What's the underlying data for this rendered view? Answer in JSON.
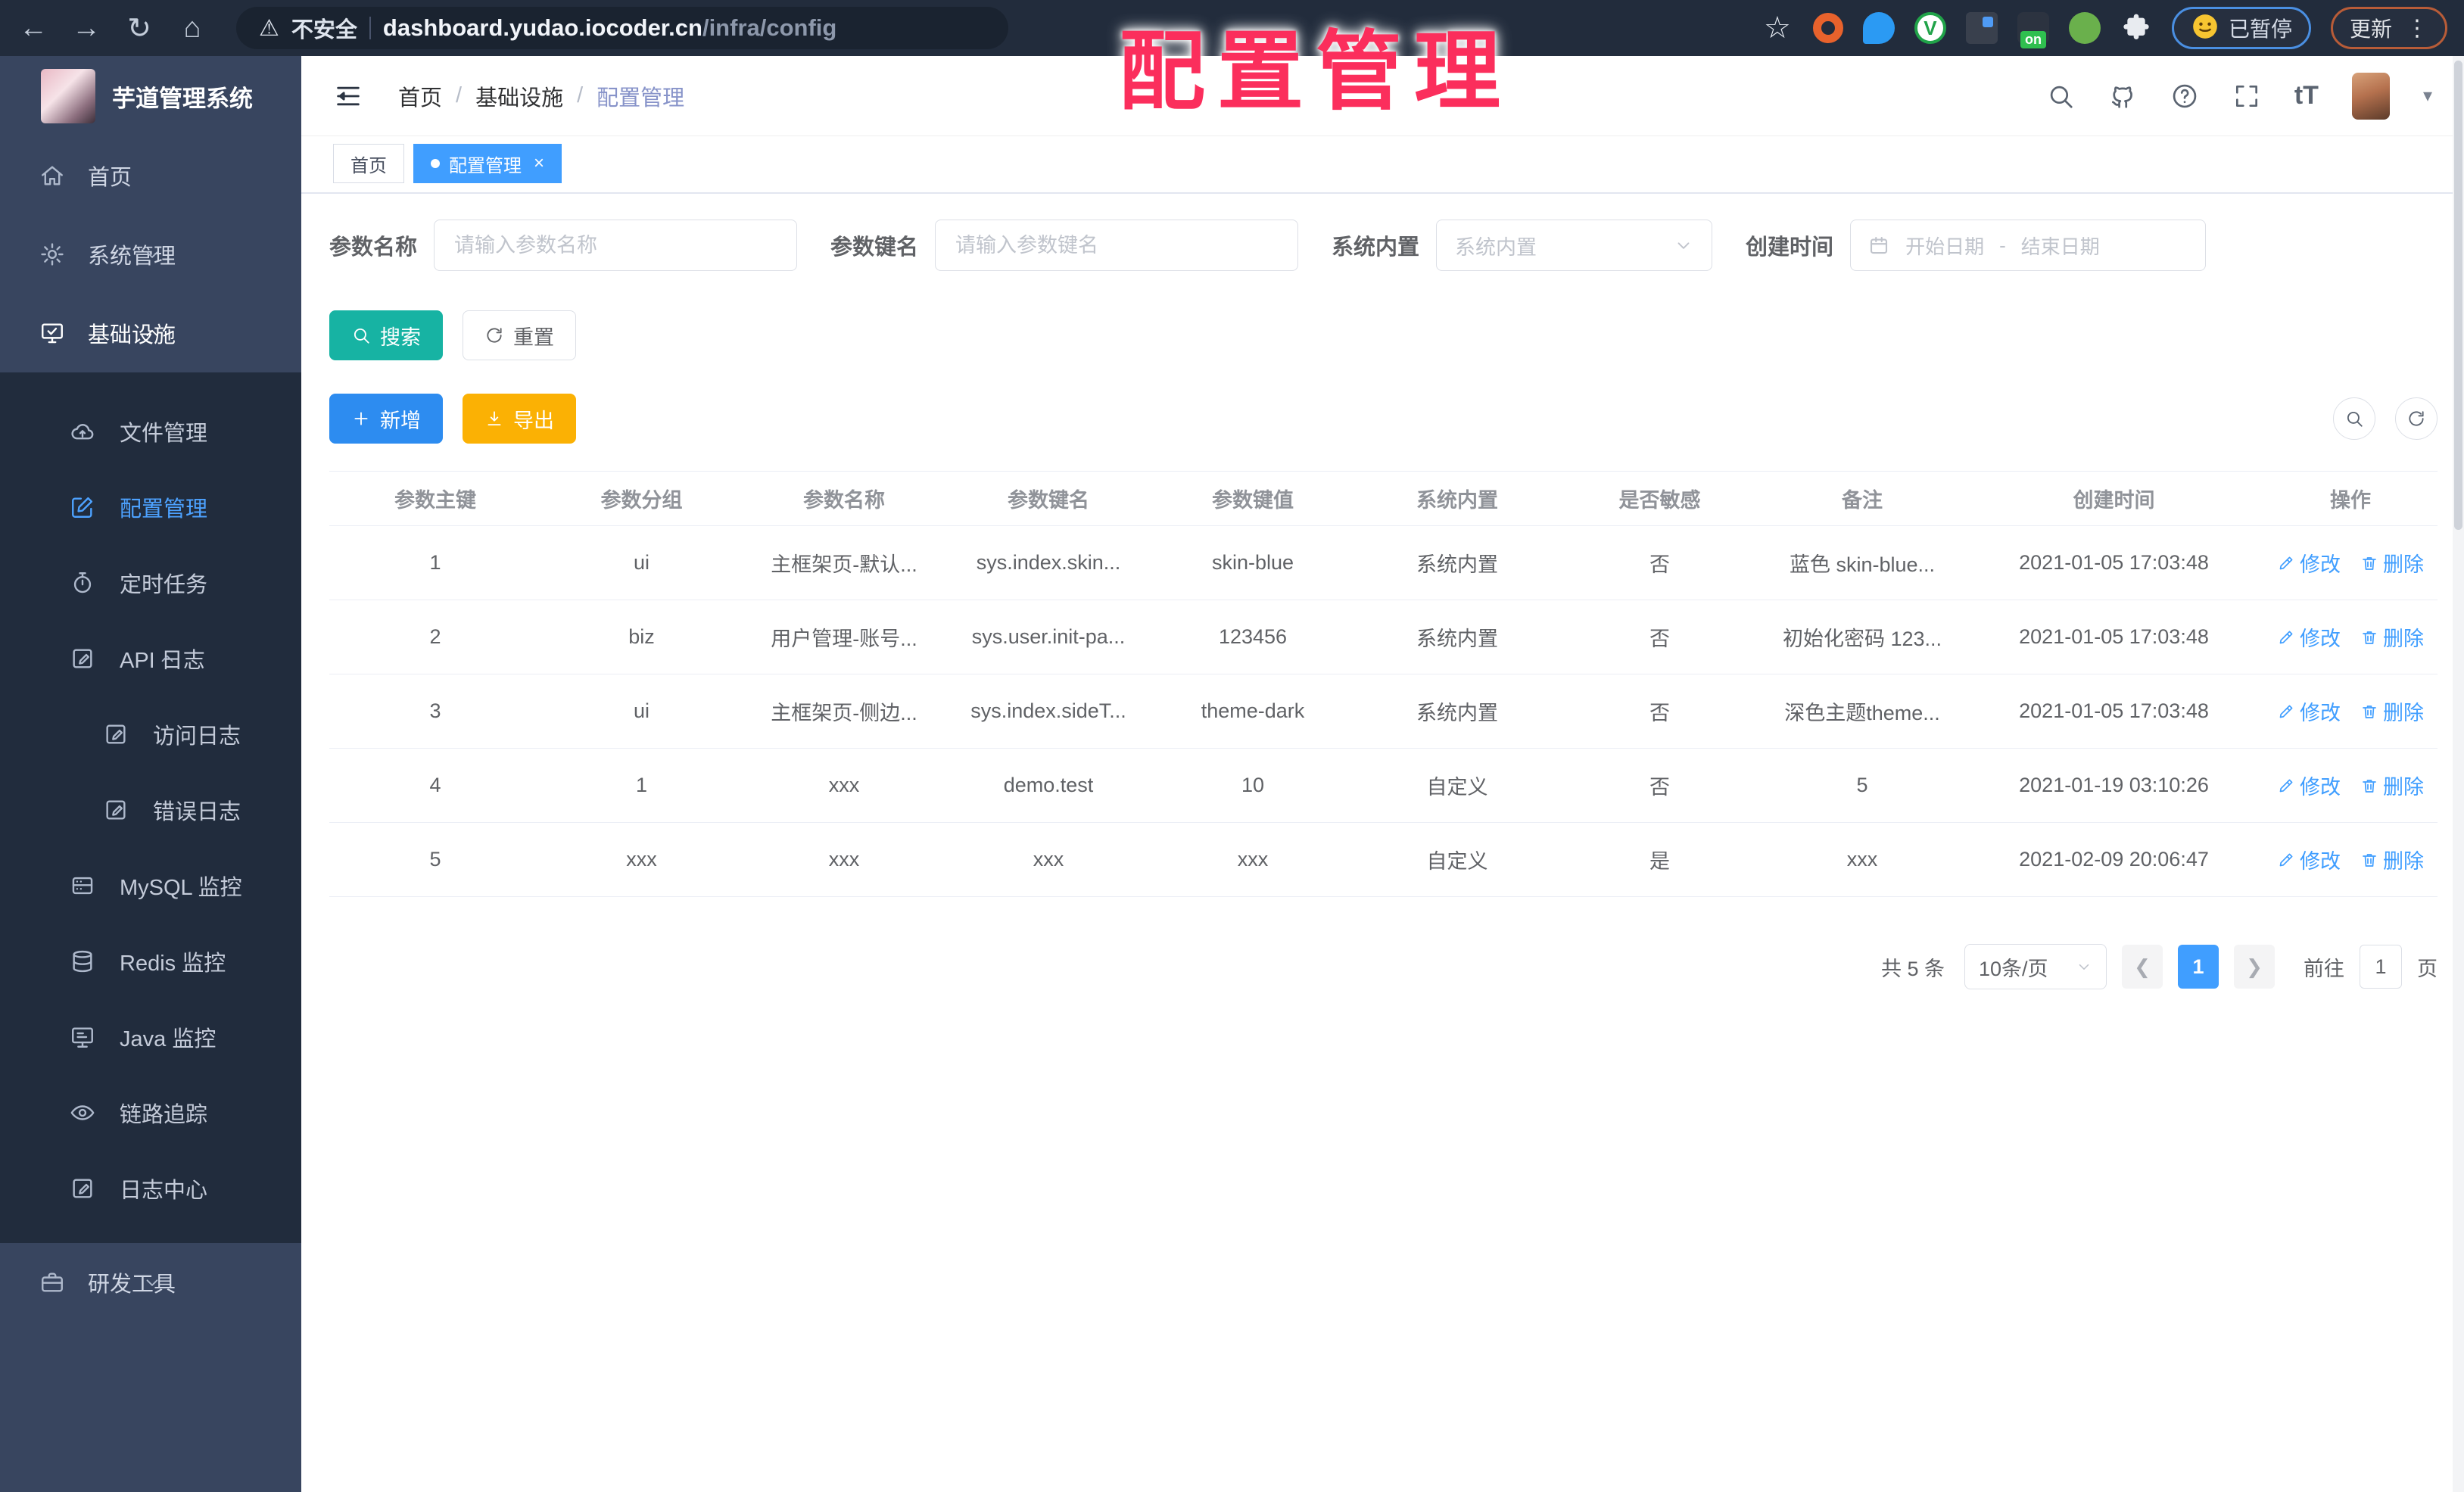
{
  "browser": {
    "security_label": "不安全",
    "url_host": "dashboard.yudao.iocoder.cn",
    "url_path": "/infra/config",
    "paused_label": "已暂停",
    "update_label": "更新"
  },
  "overlay_title": "配置管理",
  "sidebar": {
    "logo_title": "芋道管理系统",
    "top_items": [
      {
        "label": "首页",
        "icon": "home"
      },
      {
        "label": "系统管理",
        "icon": "gear",
        "chevron": "down"
      },
      {
        "label": "基础设施",
        "icon": "monitor",
        "chevron": "up",
        "active": "white"
      }
    ],
    "sub_items": [
      {
        "label": "文件管理",
        "icon": "cloud"
      },
      {
        "label": "配置管理",
        "icon": "edit",
        "active": "blue"
      },
      {
        "label": "定时任务",
        "icon": "timer"
      },
      {
        "label": "API 日志",
        "icon": "logpen",
        "chevron": "up"
      },
      {
        "label": "访问日志",
        "icon": "logpen",
        "nested": true
      },
      {
        "label": "错误日志",
        "icon": "logpen",
        "nested": true
      },
      {
        "label": "MySQL 监控",
        "icon": "database"
      },
      {
        "label": "Redis 监控",
        "icon": "stack"
      },
      {
        "label": "Java 监控",
        "icon": "display"
      },
      {
        "label": "链路追踪",
        "icon": "eye"
      },
      {
        "label": "日志中心",
        "icon": "logpen"
      }
    ],
    "bottom_items": [
      {
        "label": "研发工具",
        "icon": "briefcase",
        "chevron": "down"
      }
    ]
  },
  "header": {
    "breadcrumb": [
      "首页",
      "基础设施",
      "配置管理"
    ]
  },
  "tabs": [
    {
      "label": "首页"
    },
    {
      "label": "配置管理",
      "close": "×"
    }
  ],
  "filters": {
    "name_label": "参数名称",
    "name_placeholder": "请输入参数名称",
    "key_label": "参数键名",
    "key_placeholder": "请输入参数键名",
    "type_label": "系统内置",
    "type_placeholder": "系统内置",
    "date_label": "创建时间",
    "date_start_placeholder": "开始日期",
    "date_separator": "-",
    "date_end_placeholder": "结束日期"
  },
  "toolbar": {
    "search_label": "搜索",
    "reset_label": "重置",
    "add_label": "新增",
    "export_label": "导出"
  },
  "table": {
    "headers": [
      "参数主键",
      "参数分组",
      "参数名称",
      "参数键名",
      "参数键值",
      "系统内置",
      "是否敏感",
      "备注",
      "创建时间",
      "操作"
    ],
    "edit_label": "修改",
    "delete_label": "删除",
    "rows": [
      {
        "cells": [
          "1",
          "ui",
          "主框架页-默认...",
          "sys.index.skin...",
          "skin-blue",
          "系统内置",
          "否",
          "蓝色 skin-blue...",
          "2021-01-05 17:03:48"
        ]
      },
      {
        "cells": [
          "2",
          "biz",
          "用户管理-账号...",
          "sys.user.init-pa...",
          "123456",
          "系统内置",
          "否",
          "初始化密码 123...",
          "2021-01-05 17:03:48"
        ]
      },
      {
        "cells": [
          "3",
          "ui",
          "主框架页-侧边...",
          "sys.index.sideT...",
          "theme-dark",
          "系统内置",
          "否",
          "深色主题theme...",
          "2021-01-05 17:03:48"
        ]
      },
      {
        "cells": [
          "4",
          "1",
          "xxx",
          "demo.test",
          "10",
          "自定义",
          "否",
          "5",
          "2021-01-19 03:10:26"
        ]
      },
      {
        "cells": [
          "5",
          "xxx",
          "xxx",
          "xxx",
          "xxx",
          "自定义",
          "是",
          "xxx",
          "2021-02-09 20:06:47"
        ]
      }
    ]
  },
  "pagination": {
    "total": "共 5 条",
    "page_size": "10条/页",
    "current_page": "1",
    "goto_label": "前往",
    "goto_value": "1",
    "page_unit": "页"
  },
  "colors": {
    "primary": "#409eff",
    "search_teal": "#17b3a3",
    "export_yellow": "#fbb104",
    "overlay_red": "#fb2e5c",
    "sidebar_navy": "#38455f",
    "sidebar_submenu": "#212c3d"
  }
}
